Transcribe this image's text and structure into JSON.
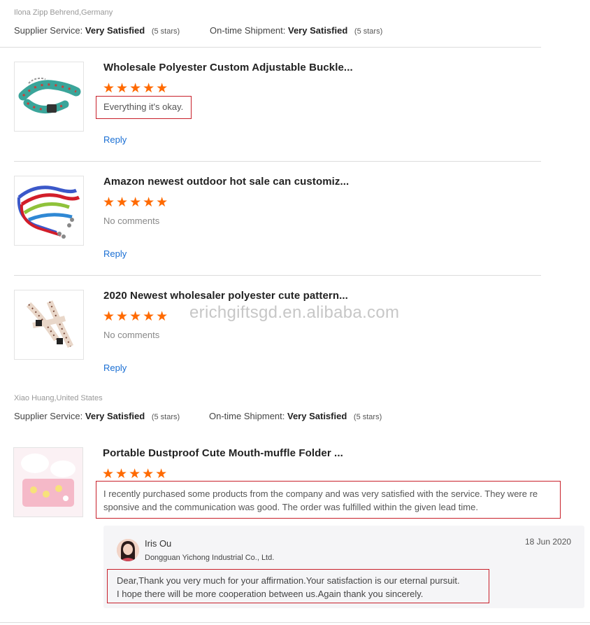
{
  "reviews": [
    {
      "reviewer": "Ilona Zipp Behrend,Germany",
      "supplier_service_label": "Supplier Service:",
      "supplier_service_value": "Very Satisfied",
      "supplier_service_stars": "(5 stars)",
      "shipment_label": "On-time Shipment:",
      "shipment_value": "Very Satisfied",
      "shipment_stars": "(5 stars)",
      "products": [
        {
          "title": "Wholesale Polyester Custom Adjustable Buckle...",
          "rating": 5,
          "stars": "★★★★★",
          "comment": "Everything it's okay.",
          "reply": "Reply"
        },
        {
          "title": "Amazon newest outdoor hot sale can customiz...",
          "rating": 5,
          "stars": "★★★★★",
          "comment": "No comments",
          "reply": "Reply"
        },
        {
          "title": "2020 Newest wholesaler polyester cute pattern...",
          "rating": 5,
          "stars": "★★★★★",
          "comment": "No comments",
          "reply": "Reply"
        }
      ]
    },
    {
      "reviewer": "Xiao Huang,United States",
      "supplier_service_label": "Supplier Service:",
      "supplier_service_value": "Very Satisfied",
      "supplier_service_stars": "(5 stars)",
      "shipment_label": "On-time Shipment:",
      "shipment_value": "Very Satisfied",
      "shipment_stars": "(5 stars)",
      "products": [
        {
          "title": "Portable Dustproof Cute Mouth-muffle Folder ...",
          "rating": 5,
          "stars": "★★★★★",
          "comment_line1": "I recently purchased some products from the company and was very satisfied with the service. They were re",
          "comment_line2": "sponsive and the communication was good. The order was fulfilled within the given lead time.",
          "supplier_reply": {
            "name": "Iris Ou",
            "company": "Dongguan Yichong Industrial Co., Ltd.",
            "date": "18 Jun 2020",
            "line1": "Dear,Thank you very much for your affirmation.Your satisfaction is our eternal pursuit.",
            "line2": "I hope there will be more cooperation between us.Again thank you sincerely."
          }
        }
      ]
    }
  ],
  "watermark": "ERICHGIFTSGD.EN.ALIBABA.COM",
  "colors": {
    "star": "#ff6a00",
    "link": "#1a6fd4",
    "highlight_box": "#c8202a"
  }
}
